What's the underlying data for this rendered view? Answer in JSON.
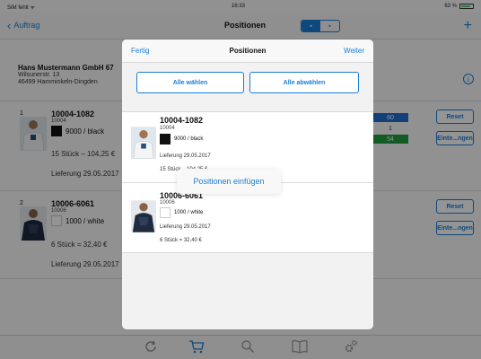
{
  "status_bar": {
    "carrier": "SIM fehlt ᯤ",
    "time": "16:33",
    "battery": "63 %"
  },
  "navbar": {
    "back_label": "Auftrag",
    "title": "Positionen",
    "segment_left": "▪",
    "segment_right": "▪",
    "add_icon": "plus-icon"
  },
  "customer": {
    "name": "Hans Mustermann GmbH 67",
    "street": "Wilsunerstr. 13",
    "city": "46499 Hamminkeln-Dingden"
  },
  "background_rows": [
    {
      "index": "1",
      "article": "10004-1082",
      "code": "10004",
      "color": "9000 / black",
      "quantity": "15 Stück – 104,25 €",
      "delivery": "Lieferung 29.05.2017",
      "reset_label": "Reset",
      "insert_label": "Einte...ngen",
      "sizes": [
        "60",
        "1",
        "54"
      ]
    },
    {
      "index": "2",
      "article": "10006-6061",
      "code": "10006",
      "color": "1000 / white",
      "quantity": "6 Stück = 32,40 €",
      "delivery": "Lieferung 29.05.2017",
      "reset_label": "Reset",
      "insert_label": "Einte...ngen"
    }
  ],
  "tabbar": {
    "tabs": [
      "refresh-icon",
      "cart-icon",
      "search-icon",
      "catalog-icon",
      "settings-icon"
    ]
  },
  "modal": {
    "done_label": "Fertig",
    "title": "Positionen",
    "next_label": "Weiter",
    "select_all_label": "Alle wählen",
    "deselect_all_label": "Alle abwählen",
    "items": [
      {
        "article": "10004-1082",
        "code": "10004",
        "color": "9000 / black",
        "delivery": "Lieferung 29.05.2017",
        "quantity": "15 Stück – 104,25 €"
      },
      {
        "article": "10006-6061",
        "code": "10006",
        "color": "1000 / white",
        "delivery": "Lieferung 29.05.2017",
        "quantity": "6 Stück = 32,40 €"
      }
    ]
  },
  "toast": {
    "label": "Positionen einfügen"
  },
  "colors": {
    "accent": "#1a7fd6",
    "size_blue": "#1f6fd1",
    "size_green": "#1f9e3f",
    "dim": "rgba(0,0,0,0.42)"
  }
}
